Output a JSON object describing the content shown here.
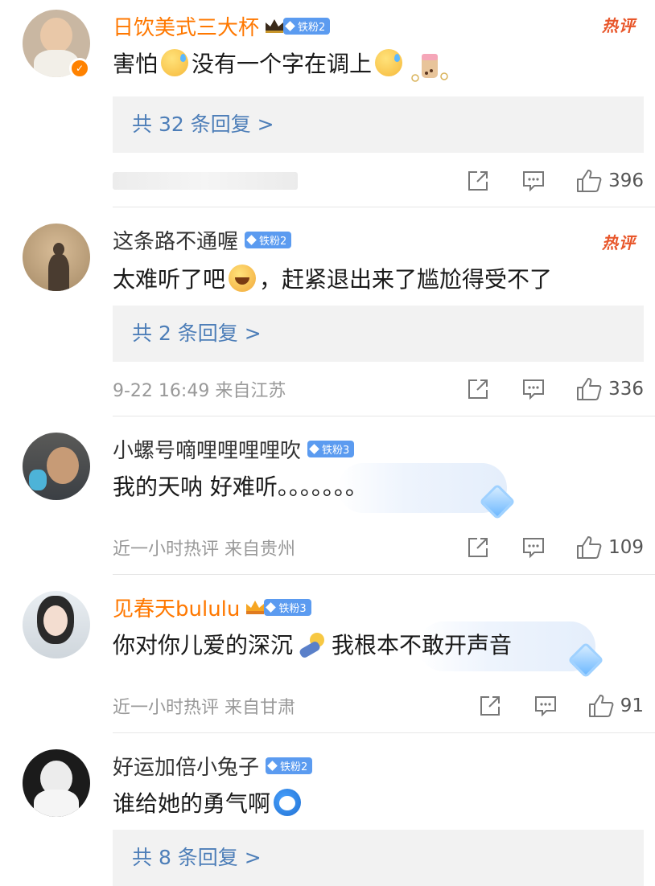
{
  "colors": {
    "vip_name": "#ff7800",
    "link": "#4d7eb8",
    "hot": "#e8562a",
    "fan_badge": "#5b9bf0",
    "meta": "#999999"
  },
  "comments": [
    {
      "username": "日饮美式三大杯",
      "fan_badge": "铁粉2",
      "hot_label": "热评",
      "text_part1": "害怕",
      "text_part2": "没有一个字在调上",
      "replies": "共 32 条回复 >",
      "likes": "396",
      "icons": [
        "sweat-emoji",
        "milk-tea-sticker"
      ]
    },
    {
      "username": "这条路不通喔",
      "fan_badge": "铁粉2",
      "hot_label": "热评",
      "text_part1": "太难听了吧",
      "text_part2": "，赶紧退出来了尴尬得受不了",
      "replies": "共 2 条回复 >",
      "meta": "9-22 16:49  来自江苏",
      "likes": "336"
    },
    {
      "username": "小螺号嘀哩哩哩哩吹",
      "fan_badge": "铁粉3",
      "text_part1": "我的天呐 好难听。。。。。。。",
      "meta": "近一小时热评  来自贵州",
      "likes": "109"
    },
    {
      "username": "见春天bululu",
      "fan_badge": "铁粉3",
      "text_part1": "你对你儿爱的深沉",
      "text_part2": "我根本不敢开声音",
      "meta": "近一小时热评  来自甘肃",
      "likes": "91"
    },
    {
      "username": "好运加倍小兔子",
      "fan_badge": "铁粉2",
      "text_part1": "谁给她的勇气啊",
      "replies": "共 8 条回复 >"
    }
  ]
}
